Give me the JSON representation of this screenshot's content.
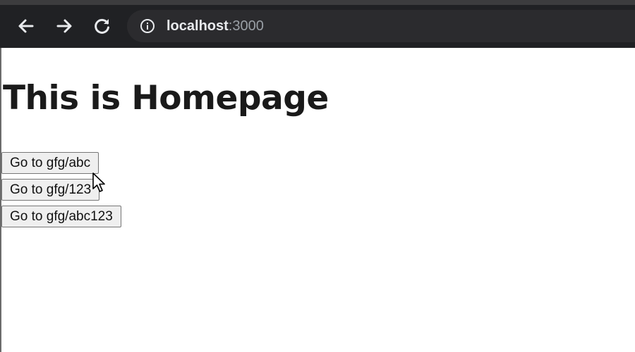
{
  "browser": {
    "url_host": "localhost",
    "url_port": ":3000",
    "icons": {
      "back": "back-arrow-icon",
      "forward": "forward-arrow-icon",
      "reload": "reload-icon",
      "info": "info-icon"
    },
    "colors": {
      "toolbar": "#202124",
      "omnibox": "#2b2b2e",
      "icon": "#e8eaed"
    }
  },
  "page": {
    "title": "This is Homepage",
    "buttons": [
      {
        "label": "Go to gfg/abc"
      },
      {
        "label": "Go to gfg/123"
      },
      {
        "label": "Go to gfg/abc123"
      }
    ]
  }
}
